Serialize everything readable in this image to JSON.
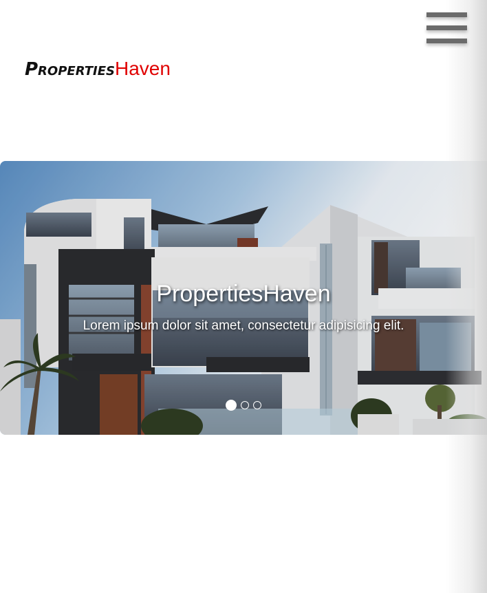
{
  "header": {
    "logo_part1": "Properties",
    "logo_part2": "Haven",
    "logo_part2_color": "#e00000",
    "menu_icon": "hamburger-menu-icon"
  },
  "carousel": {
    "slide_title": "PropertiesHaven",
    "slide_text": "Lorem ipsum dolor sit amet, consectetur adipisicing elit.",
    "slide_image": "modern-house-photo",
    "indicators": [
      {
        "label": "slide-1",
        "active": true
      },
      {
        "label": "slide-2",
        "active": false
      },
      {
        "label": "slide-3",
        "active": false
      }
    ]
  }
}
